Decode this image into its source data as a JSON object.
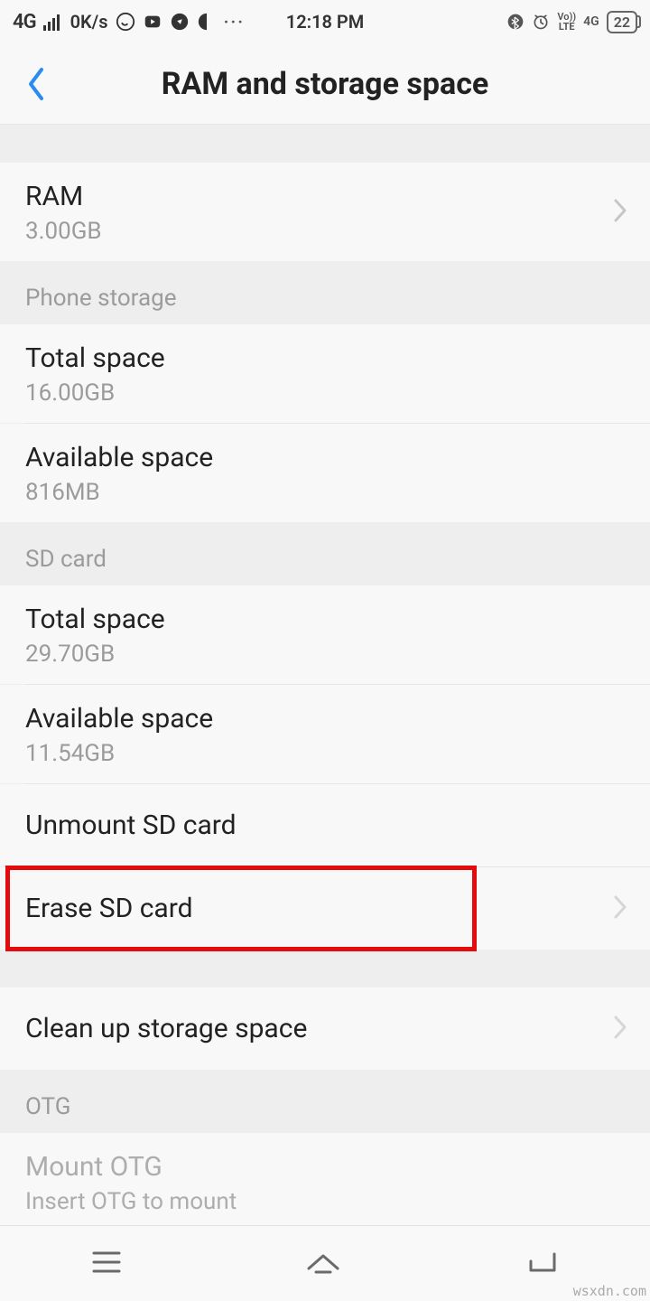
{
  "status": {
    "network": "4G",
    "speed": "0K/s",
    "time": "12:18 PM",
    "volte": "Vo))",
    "lte": "LTE",
    "net2": "4G",
    "battery": "22"
  },
  "header": {
    "title": "RAM and storage space"
  },
  "ram": {
    "label": "RAM",
    "value": "3.00GB"
  },
  "phone_storage": {
    "header": "Phone storage",
    "total_label": "Total space",
    "total_value": "16.00GB",
    "avail_label": "Available space",
    "avail_value": "816MB"
  },
  "sd_card": {
    "header": "SD card",
    "total_label": "Total space",
    "total_value": "29.70GB",
    "avail_label": "Available space",
    "avail_value": "11.54GB",
    "unmount_label": "Unmount SD card",
    "erase_label": "Erase SD card"
  },
  "cleanup": {
    "label": "Clean up storage space"
  },
  "otg": {
    "header": "OTG",
    "mount_label": "Mount OTG",
    "mount_sub": "Insert OTG to mount"
  },
  "watermark": "wsxdn.com"
}
